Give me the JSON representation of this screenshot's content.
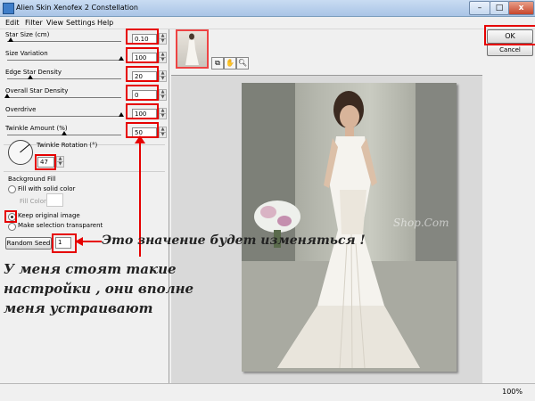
{
  "window": {
    "title": "Alien Skin Xenofex 2 Constellation",
    "min_glyph": "–",
    "max_glyph": "□",
    "close_glyph": "x"
  },
  "menu": [
    "Edit",
    "Filter",
    "View",
    "Settings",
    "Help"
  ],
  "params": [
    {
      "label": "Star Size (cm)",
      "value": "0.10",
      "level": 0.03
    },
    {
      "label": "Size Variation",
      "value": "100",
      "level": 1.0
    },
    {
      "label": "Edge Star Density",
      "value": "20",
      "level": 0.2
    },
    {
      "label": "Overall Star Density",
      "value": "0",
      "level": 0.0
    },
    {
      "label": "Overdrive",
      "value": "100",
      "level": 1.0
    },
    {
      "label": "Twinkle Amount (%)",
      "value": "50",
      "level": 0.5
    }
  ],
  "twinkle_rotation": {
    "label": "Twinkle Rotation (°)",
    "value": "47"
  },
  "background_fill": {
    "title": "Background Fill",
    "fill_solid": "Fill with solid color",
    "fill_color": "Fill Color",
    "keep_original": "Keep original image",
    "make_transparent": "Make selection transparent",
    "selected": "keep_original"
  },
  "random_seed": {
    "button": "Random Seed",
    "value": "1"
  },
  "buttons": {
    "ok": "OK",
    "cancel": "Cancel"
  },
  "tools": {
    "icons": [
      "preview-toggle-icon",
      "hand-icon",
      "zoom-icon"
    ]
  },
  "watermark": "Shop.Com",
  "status": {
    "zoom": "100%"
  },
  "annotations": {
    "seed_note": "Это значение будет изменяться !",
    "settings_note": "У меня стоят такие настройки , они вполне меня устраивают"
  },
  "colors": {
    "highlight": "#e60000",
    "ok_border": "#e60000"
  }
}
